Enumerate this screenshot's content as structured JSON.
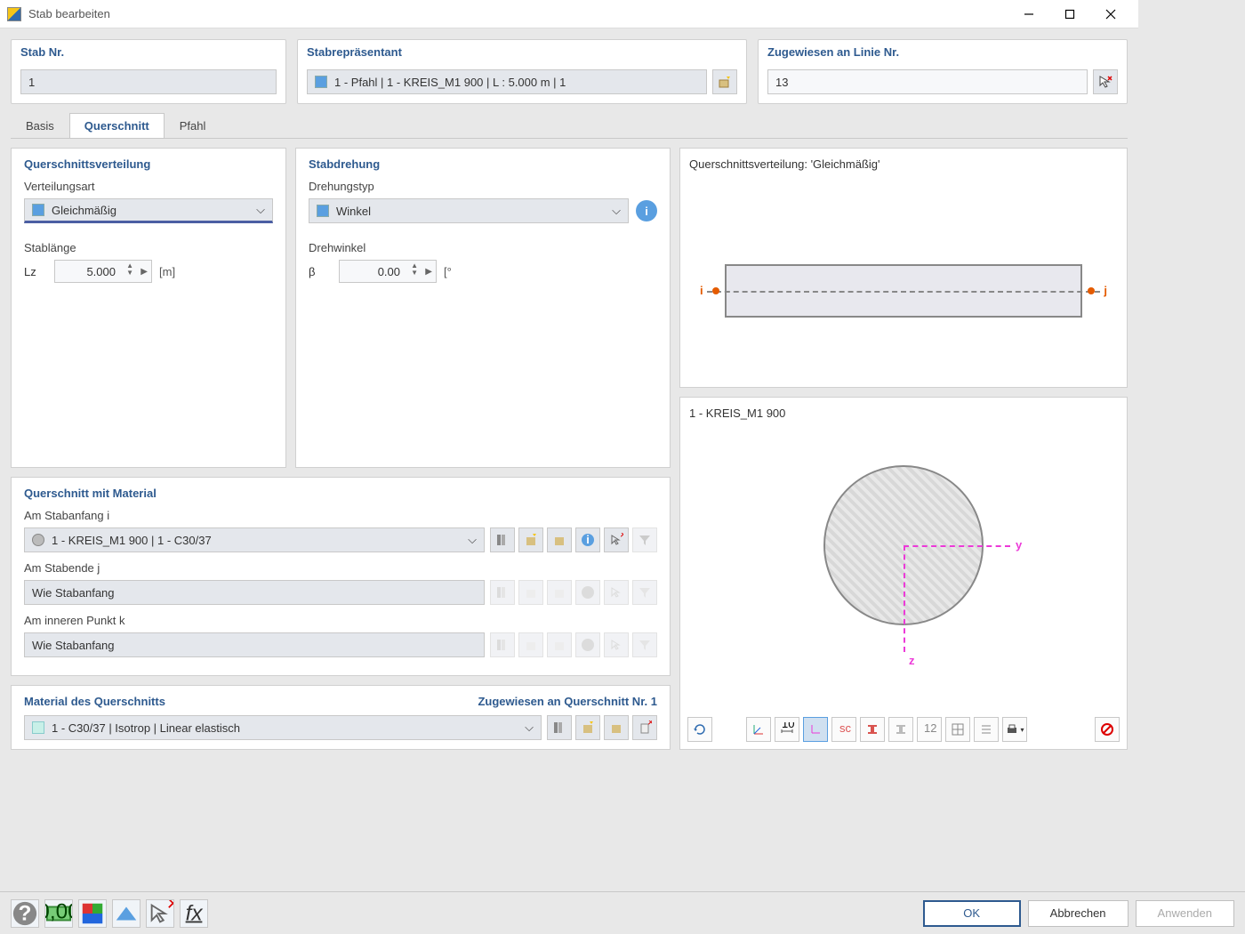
{
  "window": {
    "title": "Stab bearbeiten"
  },
  "top": {
    "stabnr": {
      "label": "Stab Nr.",
      "value": "1"
    },
    "repraesentant": {
      "label": "Stabrepräsentant",
      "value": "1 - Pfahl | 1 - KREIS_M1 900 | L : 5.000 m | 1"
    },
    "zugewiesen": {
      "label": "Zugewiesen an Linie Nr.",
      "value": "13"
    }
  },
  "tabs": {
    "basis": "Basis",
    "querschnitt": "Querschnitt",
    "pfahl": "Pfahl"
  },
  "verteilung": {
    "title": "Querschnittsverteilung",
    "artLabel": "Verteilungsart",
    "artValue": "Gleichmäßig",
    "lenLabel": "Stablänge",
    "lenSym": "Lz",
    "lenVal": "5.000",
    "lenUnit": "[m]"
  },
  "drehung": {
    "title": "Stabdrehung",
    "typLabel": "Drehungstyp",
    "typValue": "Winkel",
    "angLabel": "Drehwinkel",
    "angSym": "β",
    "angVal": "0.00",
    "angUnit": "[°"
  },
  "material": {
    "title": "Querschnitt mit Material",
    "startLabel": "Am Stabanfang i",
    "startValue": "1 - KREIS_M1 900 | 1 - C30/37",
    "endLabel": "Am Stabende j",
    "endValue": "Wie Stabanfang",
    "innerLabel": "Am inneren Punkt k",
    "innerValue": "Wie Stabanfang"
  },
  "matq": {
    "title": "Material des Querschnitts",
    "assigned": "Zugewiesen an Querschnitt Nr. 1",
    "value": "1 - C30/37 | Isotrop | Linear elastisch"
  },
  "preview1": {
    "title": "Querschnittsverteilung: 'Gleichmäßig'",
    "i": "i",
    "j": "j"
  },
  "preview2": {
    "title": "1 - KREIS_M1 900",
    "y": "y",
    "z": "z"
  },
  "buttons": {
    "ok": "OK",
    "cancel": "Abbrechen",
    "apply": "Anwenden"
  }
}
